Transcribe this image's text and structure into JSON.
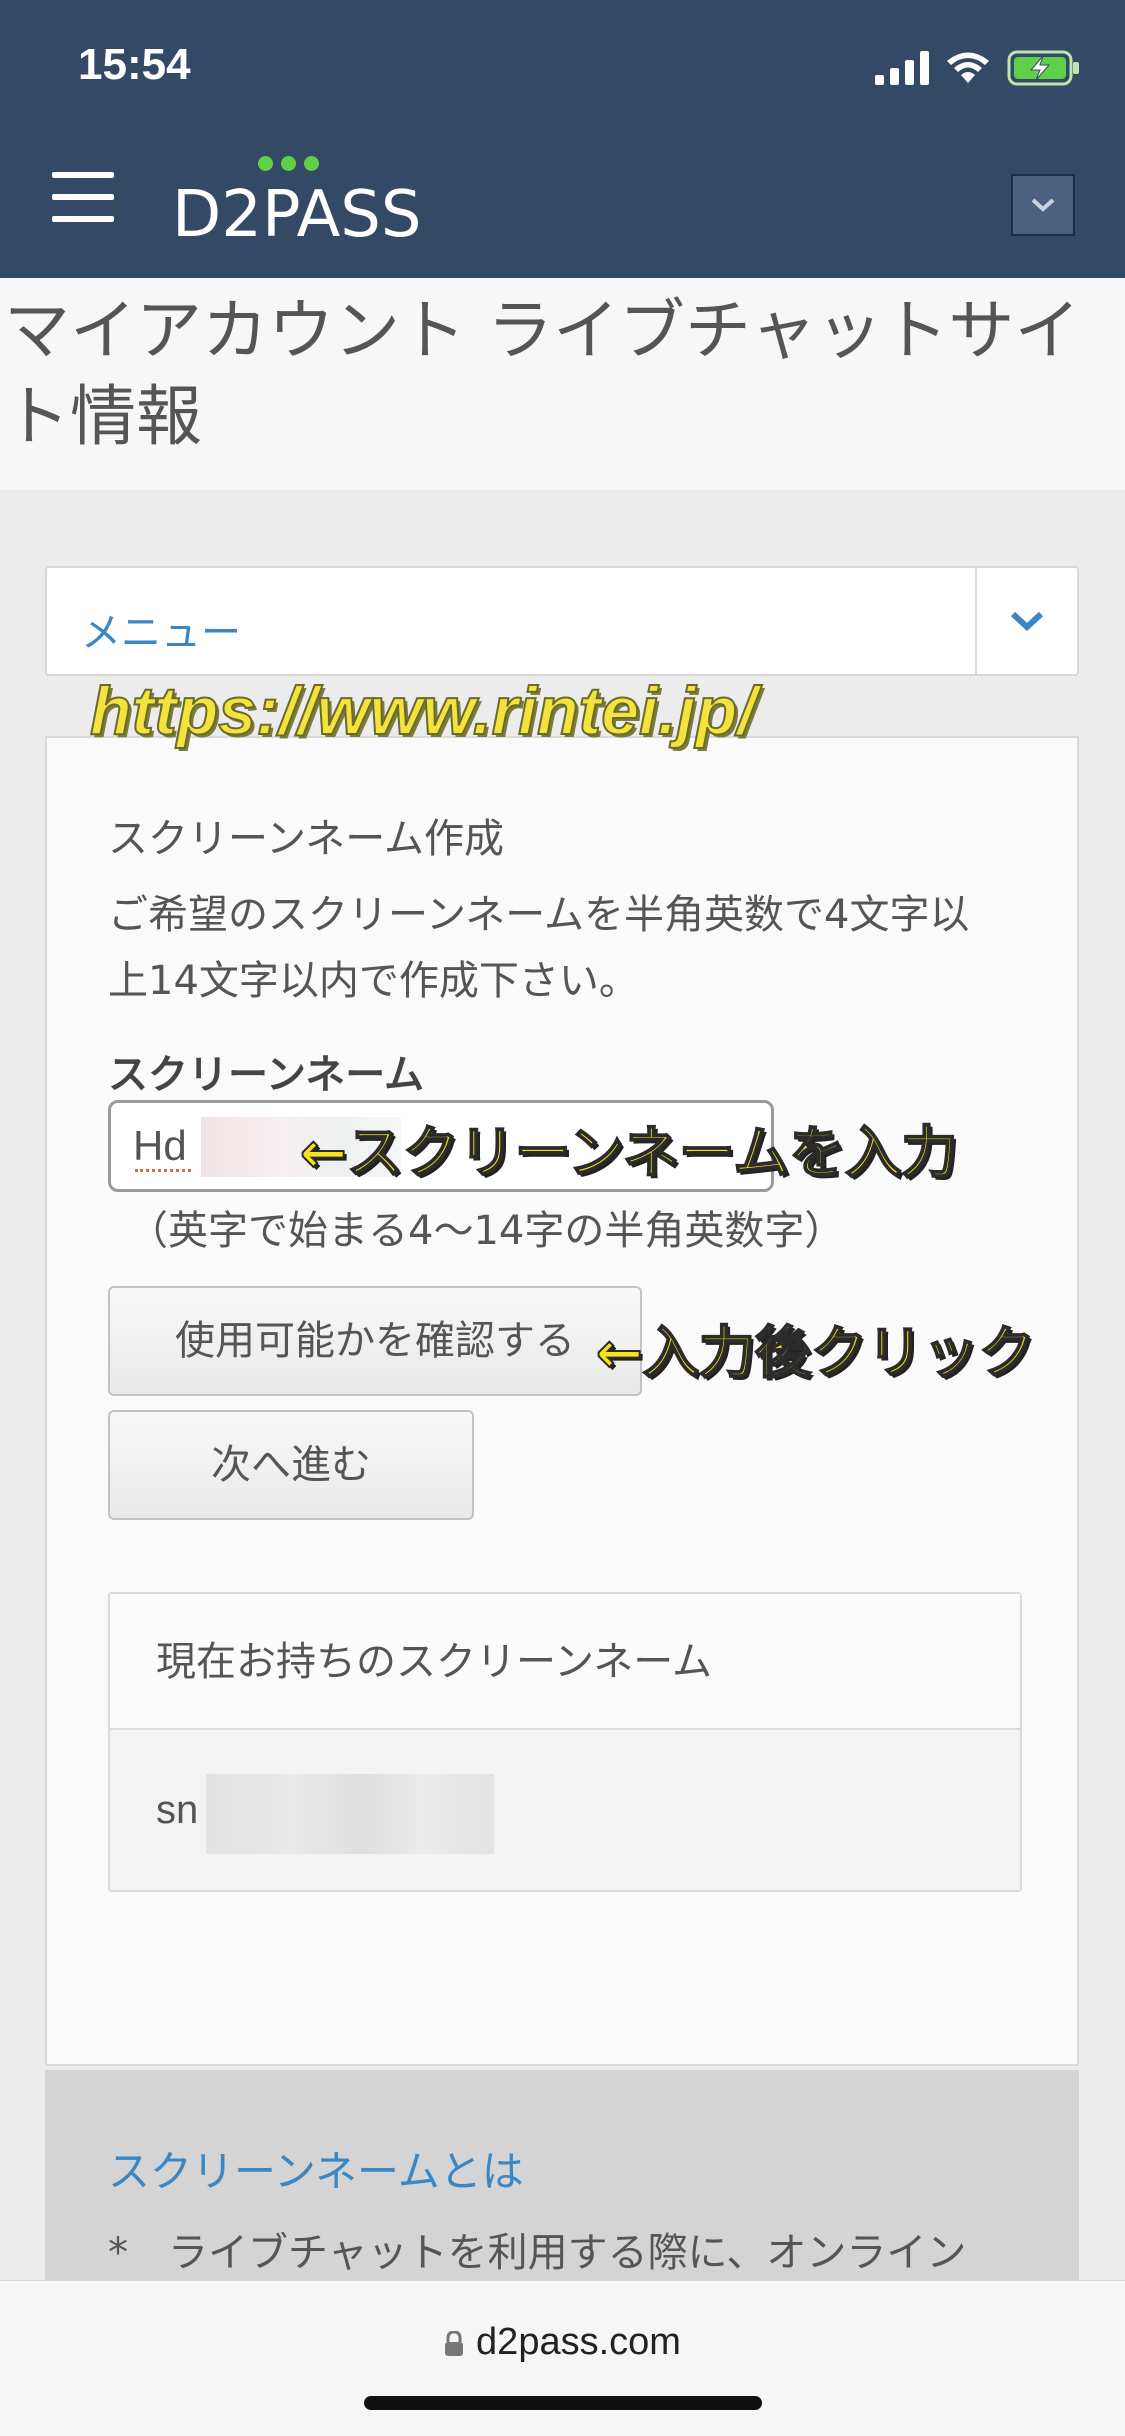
{
  "status_bar": {
    "time": "15:54"
  },
  "header": {
    "logo_text": "D2PASS"
  },
  "page": {
    "title": "マイアカウント ライブチャットサイト情報"
  },
  "menu": {
    "label": "メニュー"
  },
  "watermark": "https://www.rintei.jp/",
  "form": {
    "section_title": "スクリーンネーム作成",
    "description": "ご希望のスクリーンネームを半角英数で4文字以上14文字以内で作成下さい。",
    "field_label": "スクリーンネーム",
    "input_value": "Hd",
    "hint": "（英字で始まる4〜14字の半角英数字）",
    "check_button": "使用可能かを確認する",
    "next_button": "次へ進む"
  },
  "annotations": {
    "input_note": "←スクリーンネームを入力",
    "click_note": "←入力後クリック"
  },
  "current": {
    "heading": "現在お持ちのスクリーンネーム",
    "value": "sn"
  },
  "about": {
    "link": "スクリーンネームとは",
    "text": "*　ライブチャットを利用する際に、オンライン"
  },
  "browser": {
    "url": "d2pass.com"
  },
  "colors": {
    "header_bg": "#334966",
    "link": "#3a87c4",
    "logo_dots": "#5fd048",
    "annotation": "#f7e31a"
  }
}
